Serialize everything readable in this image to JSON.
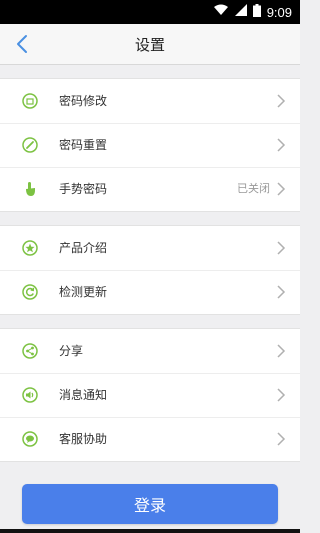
{
  "status_bar": {
    "time": "9:09",
    "icons": [
      "wifi-icon",
      "signal-icon",
      "battery-icon"
    ]
  },
  "header": {
    "title": "设置",
    "back_icon": "chevron-left-icon"
  },
  "groups": [
    {
      "items": [
        {
          "label": "密码修改",
          "icon": "password-edit-icon",
          "value": ""
        },
        {
          "label": "密码重置",
          "icon": "password-reset-icon",
          "value": ""
        },
        {
          "label": "手势密码",
          "icon": "gesture-icon",
          "value": "已关闭"
        }
      ]
    },
    {
      "items": [
        {
          "label": "产品介绍",
          "icon": "star-icon",
          "value": ""
        },
        {
          "label": "检测更新",
          "icon": "refresh-icon",
          "value": ""
        }
      ]
    },
    {
      "items": [
        {
          "label": "分享",
          "icon": "share-icon",
          "value": ""
        },
        {
          "label": "消息通知",
          "icon": "speaker-icon",
          "value": ""
        },
        {
          "label": "客服协助",
          "icon": "chat-icon",
          "value": ""
        }
      ]
    }
  ],
  "login_button": {
    "label": "登录"
  },
  "colors": {
    "accent": "#4a7fea",
    "icon_green": "#7cc242",
    "background": "#efeff1"
  }
}
